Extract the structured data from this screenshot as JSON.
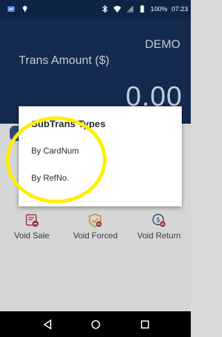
{
  "status_bar": {
    "battery_text": "100%",
    "time": "07:23",
    "icons": [
      "app-notification-icon",
      "location-pin-icon",
      "bluetooth-icon",
      "wifi-icon",
      "signal-icon",
      "battery-icon"
    ]
  },
  "header": {
    "mode_label": "DEMO",
    "amount_label": "Trans Amount ($)",
    "amount_value": "0.00"
  },
  "dialog": {
    "title": "SubTrans Types",
    "options": [
      "By CardNum",
      "By RefNo."
    ]
  },
  "actions": [
    {
      "label": "Void Sale",
      "icon": "void-sale-icon",
      "color": "#a0303a"
    },
    {
      "label": "Void Forced",
      "icon": "void-forced-icon",
      "color": "#c08a2a"
    },
    {
      "label": "Void Return",
      "icon": "void-return-icon",
      "color": "#2f4a78"
    }
  ],
  "nav": {
    "icons": [
      "back-icon",
      "home-icon",
      "recents-icon"
    ]
  },
  "colors": {
    "header_bg": "#142a4f",
    "status_bg": "#0e2446",
    "highlight": "#ffee00"
  }
}
